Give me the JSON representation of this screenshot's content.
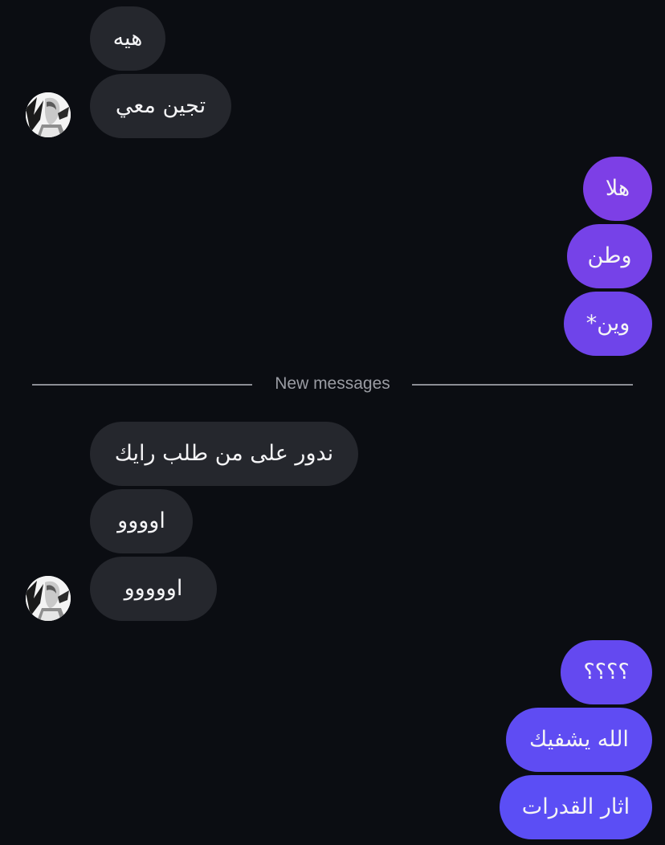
{
  "conversation": {
    "incoming_group_1": [
      "هيه",
      "تجين معي"
    ],
    "outgoing_group_1": [
      "هلا",
      "وطن",
      "وين*"
    ],
    "divider_label": "New messages",
    "incoming_group_2": [
      "ندور على من طلب رايك",
      "اوووو",
      "اووووو"
    ],
    "outgoing_group_2": [
      "؟؟؟؟",
      "الله يشفيك",
      "اثار القدرات"
    ]
  },
  "colors": {
    "background": "#0b0d12",
    "incoming_bubble": "#25272d",
    "outgoing_top": "#7d3fe6",
    "outgoing_bottom": "#5b4ef5",
    "divider": "#8b8d94"
  },
  "icons": {
    "avatar": "anime-character-avatar"
  }
}
